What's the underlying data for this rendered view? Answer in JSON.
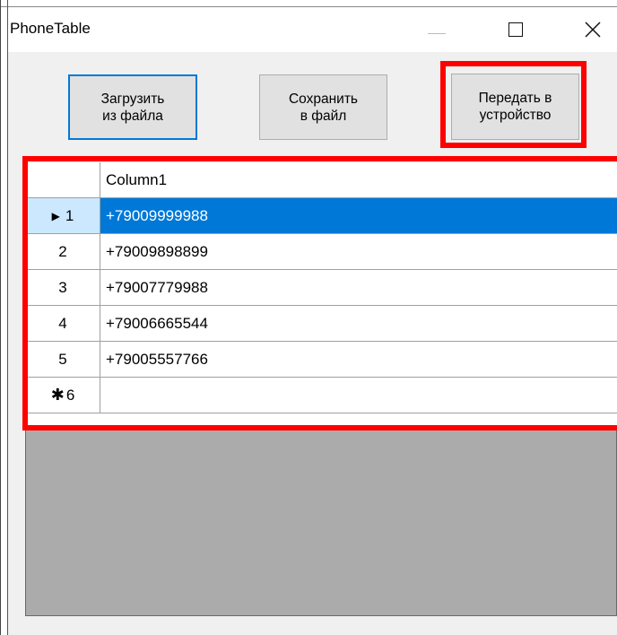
{
  "window": {
    "title": "PhoneTable"
  },
  "toolbar": {
    "load_label": "Загрузить\nиз файла",
    "save_label": "Сохранить\nв файл",
    "send_label": "Передать в\nустройство"
  },
  "grid": {
    "column_header": "Column1",
    "rows": [
      {
        "number": "1",
        "value": "+79009999988",
        "marker": "▶",
        "selected": true
      },
      {
        "number": "2",
        "value": "+79009898899"
      },
      {
        "number": "3",
        "value": "+79007779988"
      },
      {
        "number": "4",
        "value": "+79006665544"
      },
      {
        "number": "5",
        "value": "+79005557766"
      },
      {
        "number": "6",
        "value": "",
        "marker": "✱",
        "new_row": true
      }
    ]
  },
  "colors": {
    "highlight": "#ff0000",
    "selection": "#0078d7",
    "selection_header": "#cce8ff",
    "grid_background": "#ababab"
  }
}
